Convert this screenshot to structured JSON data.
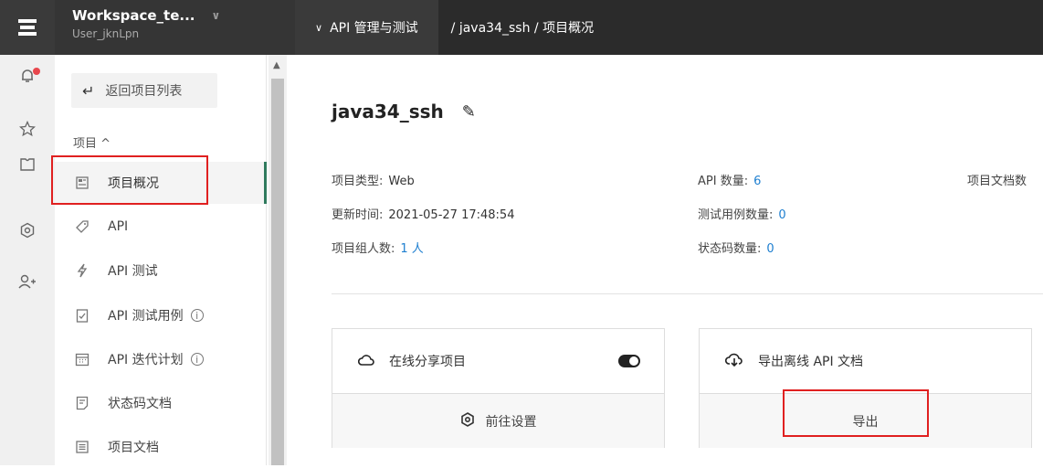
{
  "workspace": {
    "name": "Workspace_te...",
    "user": "User_jknLpn"
  },
  "breadcrumb": {
    "menu": "API 管理与测试",
    "path": "/ java34_ssh / 项目概况"
  },
  "sidebar": {
    "back_label": "返回项目列表",
    "group_label": "项目 ^",
    "items": [
      {
        "label": "项目概况",
        "icon": "dashboard-icon"
      },
      {
        "label": "API",
        "icon": "tag-icon"
      },
      {
        "label": "API 测试",
        "icon": "lightning-icon"
      },
      {
        "label": "API 测试用例",
        "icon": "clipboard-check-icon",
        "info": "i"
      },
      {
        "label": "API 迭代计划",
        "icon": "calendar-icon",
        "info": "i"
      },
      {
        "label": "状态码文档",
        "icon": "doc-icon"
      },
      {
        "label": "项目文档",
        "icon": "list-doc-icon"
      }
    ]
  },
  "project": {
    "title": "java34_ssh",
    "type_label": "项目类型:",
    "type_value": "Web",
    "updated_label": "更新时间:",
    "updated_value": "2021-05-27 17:48:54",
    "members_label": "项目组人数:",
    "members_value": "1 人",
    "api_count_label": "API 数量:",
    "api_count_value": "6",
    "testcase_label": "测试用例数量:",
    "testcase_value": "0",
    "statuscode_label": "状态码数量:",
    "statuscode_value": "0",
    "docs_label": "项目文档数"
  },
  "cards": {
    "share": {
      "title": "在线分享项目",
      "action": "前往设置"
    },
    "export": {
      "title": "导出离线 API 文档",
      "action": "导出"
    }
  },
  "colors": {
    "accent": "#2f7a5d",
    "link": "#1e7fd0",
    "highlight": "#e02020"
  }
}
